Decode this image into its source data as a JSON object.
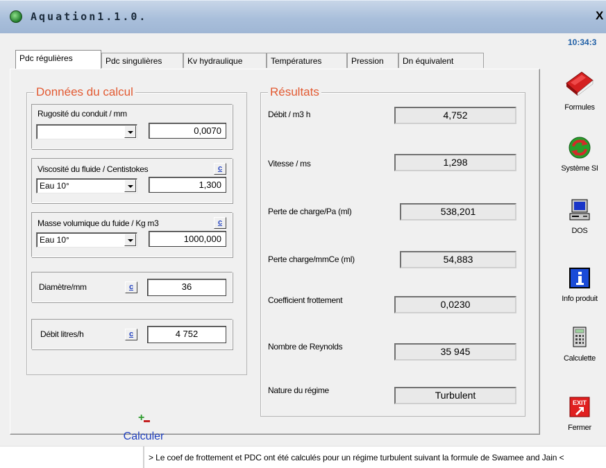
{
  "window": {
    "title": "Aquation1.1.0.",
    "close_label": "X",
    "clock": "10:34:3"
  },
  "tabs": [
    {
      "label": "Pdc régulières",
      "active": true
    },
    {
      "label": "Pdc singulières"
    },
    {
      "label": "Kv hydraulique"
    },
    {
      "label": "Températures"
    },
    {
      "label": "Pression"
    },
    {
      "label": "Dn équivalent"
    }
  ],
  "inputs": {
    "title": "Données du calcul",
    "rugosite": {
      "label": "Rugosité du conduit / mm",
      "select": "",
      "value": "0,0070"
    },
    "viscosite": {
      "label": "Viscosité du fluide / Centistokes",
      "c_label": "c",
      "select": "Eau 10°",
      "value": "1,300"
    },
    "masse": {
      "label": "Masse volumique du fuide / Kg m3",
      "c_label": "c",
      "select": "Eau 10°",
      "value": "1000,000"
    },
    "diametre": {
      "label": "Diamètre/mm",
      "c_label": "c",
      "value": "36"
    },
    "debit": {
      "label": "Débit litres/h",
      "c_label": "c",
      "value": "4 752"
    },
    "calculer": "Calculer"
  },
  "results": {
    "title": "Résultats",
    "rows": [
      {
        "label": "Débit / m3 h",
        "value": "4,752"
      },
      {
        "label": "Vitesse / ms",
        "value": "1,298"
      },
      {
        "label": "Perte de charge/Pa (ml)",
        "value": "538,201"
      },
      {
        "label": "Perte charge/mmCe (ml)",
        "value": "54,883"
      },
      {
        "label": "Coefficient frottement",
        "value": "0,0230"
      },
      {
        "label": "Nombre de Reynolds",
        "value": "35 945"
      },
      {
        "label": "Nature du régime",
        "value": "Turbulent"
      }
    ]
  },
  "sidebar": {
    "formules": "Formules",
    "systeme": "Système SI",
    "dos": "DOS",
    "info": "Info produit",
    "calculette": "Calculette",
    "fermer": "Fermer",
    "exit_text": "EXIT"
  },
  "status": "> Le coef de frottement et PDC ont été calculés pour un régime turbulent suivant la formule de Swamee and Jain <",
  "colors": {
    "accent": "#e25a32",
    "link": "#1f3fbf",
    "clock": "#1f5fa6"
  }
}
